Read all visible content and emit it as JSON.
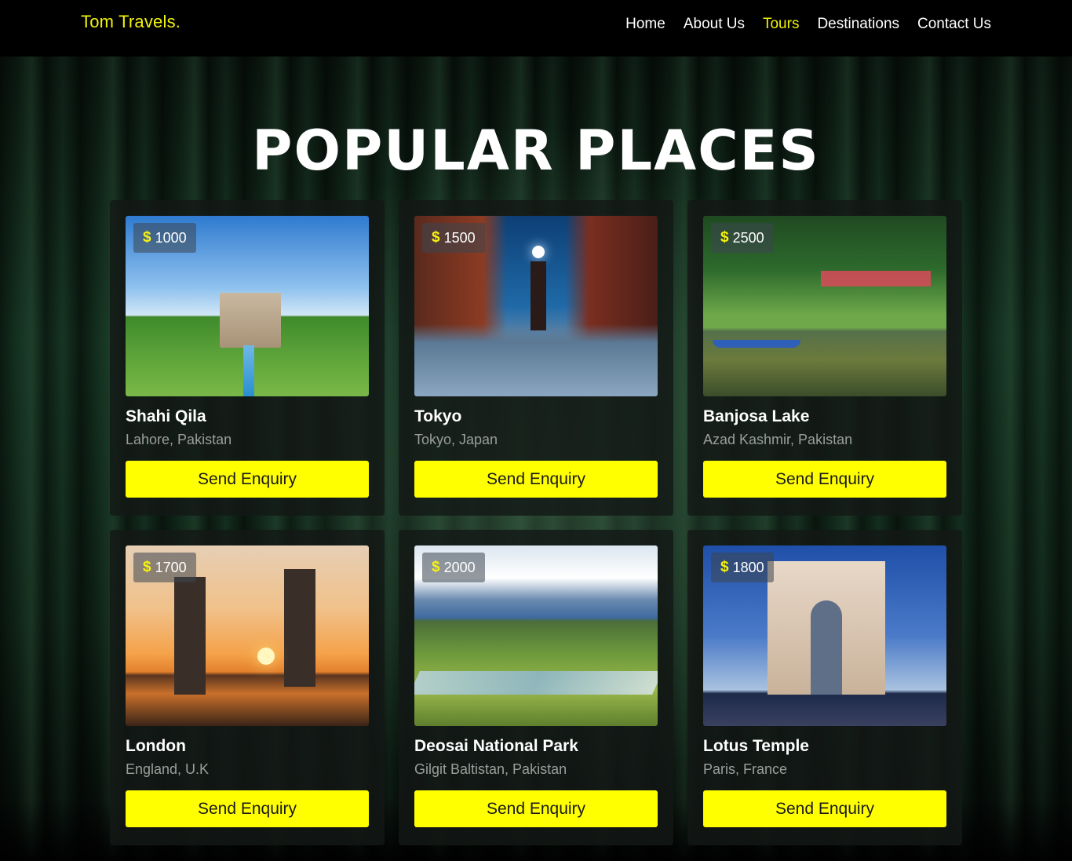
{
  "brand": "Tom Travels.",
  "nav": [
    {
      "label": "Home",
      "active": false
    },
    {
      "label": "About Us",
      "active": false
    },
    {
      "label": "Tours",
      "active": true
    },
    {
      "label": "Destinations",
      "active": false
    },
    {
      "label": "Contact Us",
      "active": false
    }
  ],
  "heading": "POPULAR PLACES",
  "currency_symbol": "$",
  "cards": [
    {
      "price": "1000",
      "title": "Shahi Qila",
      "location": "Lahore, Pakistan",
      "button": "Send Enquiry"
    },
    {
      "price": "1500",
      "title": "Tokyo",
      "location": "Tokyo, Japan",
      "button": "Send Enquiry"
    },
    {
      "price": "2500",
      "title": "Banjosa Lake",
      "location": "Azad Kashmir, Pakistan",
      "button": "Send Enquiry"
    },
    {
      "price": "1700",
      "title": "London",
      "location": "England, U.K",
      "button": "Send Enquiry"
    },
    {
      "price": "2000",
      "title": "Deosai National Park",
      "location": "Gilgit Baltistan, Pakistan",
      "button": "Send Enquiry"
    },
    {
      "price": "1800",
      "title": "Lotus Temple",
      "location": "Paris, France",
      "button": "Send Enquiry"
    }
  ],
  "colors": {
    "accent": "#ffff00",
    "brand": "#f2f20a",
    "nav_bg": "#000000",
    "card_bg": "#141816"
  }
}
